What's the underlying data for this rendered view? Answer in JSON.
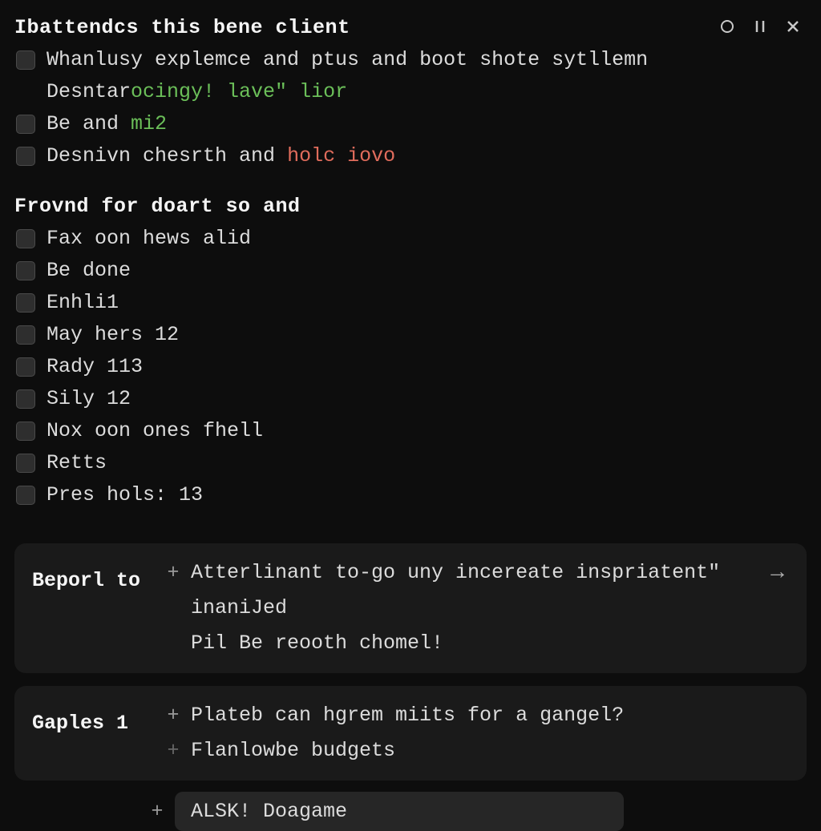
{
  "sections": [
    {
      "title": "Ibattendcs this bene client",
      "items": [
        {
          "segments": [
            {
              "text": "Whanlusy explemce and ptus and boot shote sytllemn",
              "cls": ""
            }
          ],
          "indent": [
            {
              "segments": [
                {
                  "text": "Desntar",
                  "cls": ""
                },
                {
                  "text": "ocingy! lave\" lior",
                  "cls": "green"
                }
              ]
            }
          ]
        },
        {
          "segments": [
            {
              "text": "Be and ",
              "cls": ""
            },
            {
              "text": "mi2",
              "cls": "green"
            }
          ]
        },
        {
          "segments": [
            {
              "text": "Desnivn chesrth and ",
              "cls": ""
            },
            {
              "text": "holc iovo",
              "cls": "red"
            }
          ]
        }
      ]
    },
    {
      "title": "Frovnd for doart so and",
      "items": [
        {
          "segments": [
            {
              "text": "Fax oon hews alid",
              "cls": ""
            }
          ]
        },
        {
          "segments": [
            {
              "text": "Be done",
              "cls": ""
            }
          ]
        },
        {
          "segments": [
            {
              "text": "Enhli1",
              "cls": ""
            }
          ]
        },
        {
          "segments": [
            {
              "text": "May hers 12",
              "cls": ""
            }
          ]
        },
        {
          "segments": [
            {
              "text": "Rady 113",
              "cls": ""
            }
          ]
        },
        {
          "segments": [
            {
              "text": "Sily 12",
              "cls": ""
            }
          ]
        },
        {
          "segments": [
            {
              "text": "Nox oon ones fhell",
              "cls": ""
            }
          ]
        },
        {
          "segments": [
            {
              "text": "Retts",
              "cls": ""
            }
          ]
        },
        {
          "segments": [
            {
              "text": "Pres hols: 13",
              "cls": ""
            }
          ]
        }
      ]
    }
  ],
  "cards": [
    {
      "label": "Beporl to",
      "arrow": true,
      "lines": [
        {
          "plus": "+",
          "text": "Atterlinant to-go uny incereate inspriatent\""
        },
        {
          "plus": "",
          "text": "inaniJed"
        },
        {
          "plus": "",
          "text": "Pil Be reooth chomel!"
        }
      ]
    },
    {
      "label": "Gaples 1",
      "arrow": false,
      "lines": [
        {
          "plus": "+",
          "text": "Plateb can hgrem miits for a gangel?"
        },
        {
          "plus": "+",
          "text": "Flanlowbe budgets",
          "dim": true
        }
      ]
    }
  ],
  "chip": {
    "plus": "+",
    "text": "ALSK! Doagame"
  }
}
